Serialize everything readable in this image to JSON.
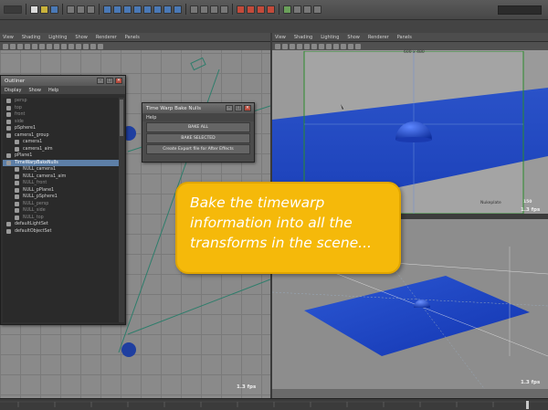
{
  "viewport_menu": [
    "View",
    "Shading",
    "Lighting",
    "Show",
    "Renderer",
    "Panels"
  ],
  "outliner": {
    "title": "Outliner",
    "menu": [
      "Display",
      "Show",
      "Help"
    ],
    "items": [
      {
        "label": "persp",
        "dim": true
      },
      {
        "label": "top",
        "dim": true
      },
      {
        "label": "front",
        "dim": true
      },
      {
        "label": "side",
        "dim": true
      },
      {
        "label": "pSphere1",
        "dim": false
      },
      {
        "label": "camera1_group",
        "dim": false
      },
      {
        "label": "camera1",
        "dim": false
      },
      {
        "label": "camera1_aim",
        "dim": false
      },
      {
        "label": "pPlane1",
        "dim": false
      },
      {
        "label": "TimeWarpBakeNulls",
        "dim": false,
        "selected": true
      },
      {
        "label": "NULL_camera1",
        "dim": false
      },
      {
        "label": "NULL_camera1_aim",
        "dim": false
      },
      {
        "label": "NULL_front",
        "dim": true
      },
      {
        "label": "NULL_pPlane1",
        "dim": false
      },
      {
        "label": "NULL_pSphere1",
        "dim": false
      },
      {
        "label": "NULL_persp",
        "dim": true
      },
      {
        "label": "NULL_side",
        "dim": true
      },
      {
        "label": "NULL_top",
        "dim": true
      },
      {
        "label": "defaultLightSet",
        "dim": false
      },
      {
        "label": "defaultObjectSet",
        "dim": false
      }
    ]
  },
  "bake_dialog": {
    "title": "Time Warp Bake Nulls",
    "menu": "Help",
    "buttons": [
      "BAKE ALL",
      "BAKE SELECTED",
      "Create Export file for After Effects"
    ]
  },
  "callout_text": "Bake the timewarp information into all the transforms in the scene...",
  "viewport_top_right": {
    "resolution": "600 x 480",
    "fps": "1.3 fps",
    "cam_label": "Camera1",
    "cam_label2": "Nukeplate"
  },
  "viewport_bottom_right": {
    "fps": "1.3 fps"
  },
  "viewport_left": {
    "fps": "1.3 fps"
  },
  "frame_marker": "150"
}
